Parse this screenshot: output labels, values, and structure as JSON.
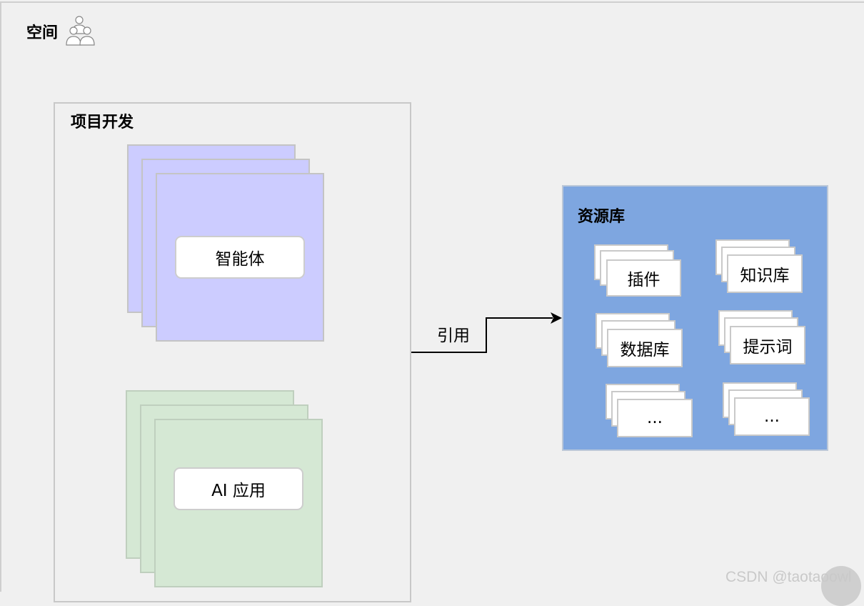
{
  "space": {
    "title": "空间",
    "icon": "users-group-icon"
  },
  "project": {
    "title": "项目开发",
    "agent_label": "智能体",
    "app_label": "AI 应用"
  },
  "edge": {
    "label": "引用"
  },
  "library": {
    "title": "资源库",
    "items": [
      "插件",
      "知识库",
      "数据库",
      "提示词",
      "...",
      "..."
    ]
  },
  "colors": {
    "agent_fill": "#ccccff",
    "app_fill": "#d5e8d4",
    "library_fill": "#7ea6e0",
    "background": "#f0f0f0"
  },
  "watermark": {
    "text": "CSDN @taotaoowl"
  }
}
